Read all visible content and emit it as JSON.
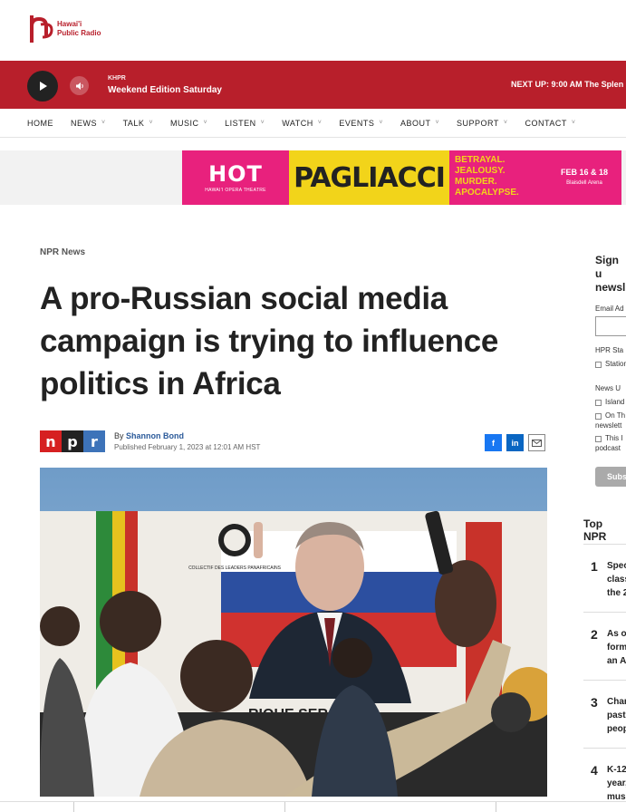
{
  "logo": {
    "line1": "Hawai'i",
    "line2": "Public Radio"
  },
  "player": {
    "station": "KHPR",
    "show": "Weekend Edition Saturday",
    "next_up": "NEXT UP: 9:00 AM The Splen"
  },
  "nav": [
    "HOME",
    "NEWS",
    "TALK",
    "MUSIC",
    "LISTEN",
    "WATCH",
    "EVENTS",
    "ABOUT",
    "SUPPORT",
    "CONTACT"
  ],
  "ad": {
    "hot": "HOT",
    "hot_sub": "HAWAI'I OPERA THEATRE",
    "title": "PAGLIACCI",
    "tagline": [
      "BETRAYAL.",
      "JEALOUSY.",
      "MURDER.",
      "APOCALYPSE."
    ],
    "date": "FEB 16 & 18",
    "venue": "Blaisdell Arena"
  },
  "article": {
    "kicker": "NPR News",
    "headline": "A pro-Russian social media campaign is trying to influence politics in Africa",
    "by_prefix": "By ",
    "author": "Shannon Bond",
    "published": "Published February 1, 2023 at 12:01 AM HST",
    "npr_letters": [
      "n",
      "p",
      "r"
    ]
  },
  "photo": {
    "banner_text": "RIQUE SERA L",
    "banner_logo": "COLLECTIF DES LEADERS PANAFRICAINS"
  },
  "sidebar": {
    "title_l1": "Sign u",
    "title_l2": "newsl",
    "email_label": "Email Ad",
    "hpr_label": "HPR Sta",
    "hpr_opt": "Station",
    "news_label": "News U",
    "opt1": "Island",
    "opt2a": "On Th",
    "opt2b": "newslett",
    "opt3a": "This I",
    "opt3b": "podcast",
    "subscribe": "Subs",
    "top_npr": "Top NPR",
    "top_items": [
      {
        "num": "1",
        "lines": [
          "Spec",
          "class",
          "the 2"
        ]
      },
      {
        "num": "2",
        "lines": [
          "As o",
          "form",
          "an A"
        ]
      },
      {
        "num": "3",
        "lines": [
          "Char",
          "past",
          "peop"
        ]
      },
      {
        "num": "4",
        "lines": [
          "K-12",
          "year,",
          "mus"
        ]
      }
    ]
  },
  "colors": {
    "brand_red": "#b81f2b",
    "npr_red": "#d62021",
    "npr_black": "#222222",
    "npr_blue": "#3d73b9",
    "ad_pink": "#e8217d",
    "ad_yellow": "#f2d41a"
  }
}
